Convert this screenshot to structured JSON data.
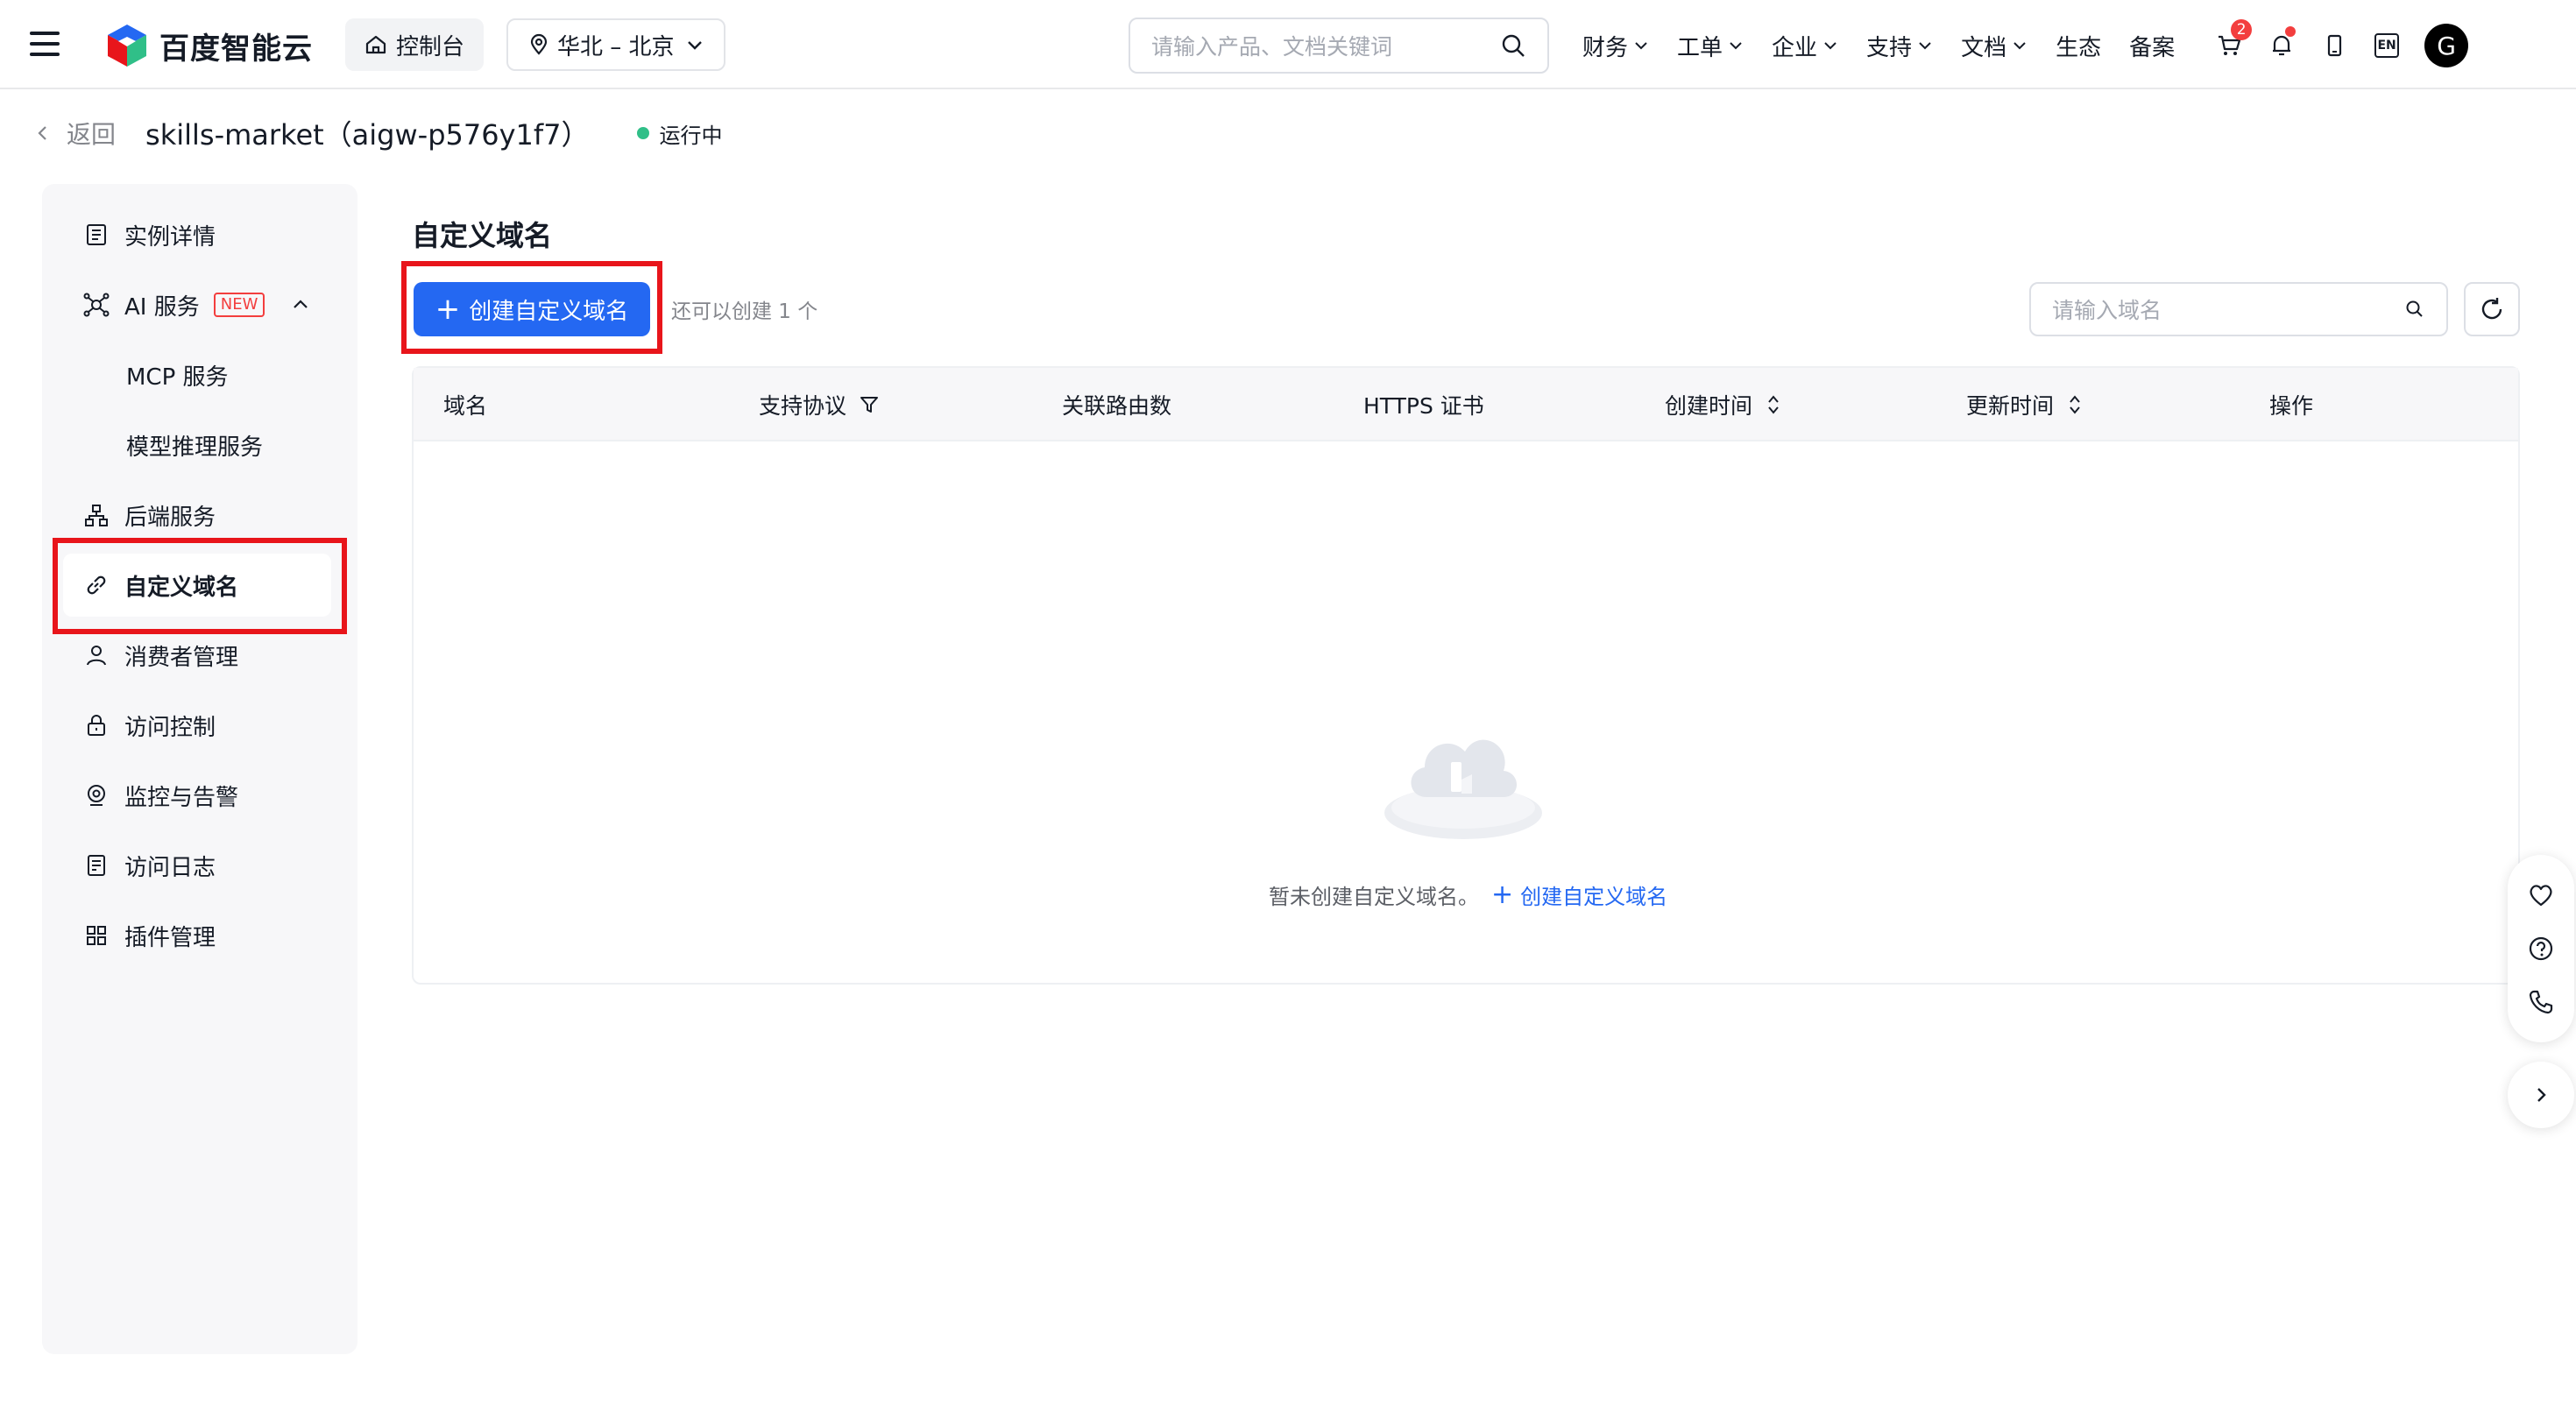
{
  "topbar": {
    "logo_text": "百度智能云",
    "console_label": "控制台",
    "region_label": "华北 – 北京",
    "search_placeholder": "请输入产品、文档关键词",
    "nav": [
      "财务",
      "工单",
      "企业",
      "支持",
      "文档",
      "生态",
      "备案"
    ],
    "nav_has_dropdown": [
      true,
      true,
      true,
      true,
      true,
      false,
      false
    ],
    "cart_badge": "2",
    "lang_label": "EN",
    "avatar_letter": "G"
  },
  "breadcrumb": {
    "back_label": "返回",
    "instance_title": "skills-market（aigw-p576y1f7）",
    "status_text": "运行中",
    "status_color": "#30bf88"
  },
  "sidebar": {
    "items": [
      {
        "label": "实例详情",
        "icon": "document-list-icon"
      },
      {
        "label": "AI 服务",
        "icon": "ai-network-icon",
        "tag": "NEW"
      },
      {
        "label": "MCP 服务"
      },
      {
        "label": "模型推理服务"
      },
      {
        "label": "后端服务",
        "icon": "org-structure-icon"
      },
      {
        "label": "自定义域名",
        "icon": "link-icon"
      },
      {
        "label": "消费者管理",
        "icon": "user-icon"
      },
      {
        "label": "访问控制",
        "icon": "lock-icon"
      },
      {
        "label": "监控与告警",
        "icon": "monitor-icon"
      },
      {
        "label": "访问日志",
        "icon": "log-icon"
      },
      {
        "label": "插件管理",
        "icon": "grid-icon"
      }
    ],
    "active_index": 5
  },
  "main": {
    "title": "自定义域名",
    "create_button": "创建自定义域名",
    "remaining_tip": "还可以创建 1 个",
    "search_placeholder": "请输入域名",
    "columns": [
      "域名",
      "支持协议",
      "关联路由数",
      "HTTPS 证书",
      "创建时间",
      "更新时间",
      "操作"
    ],
    "empty_text": "暂未创建自定义域名。",
    "empty_link": "创建自定义域名"
  },
  "colors": {
    "primary": "#2468f2",
    "highlight_box": "#e8151b",
    "badge": "#f33e3e"
  }
}
